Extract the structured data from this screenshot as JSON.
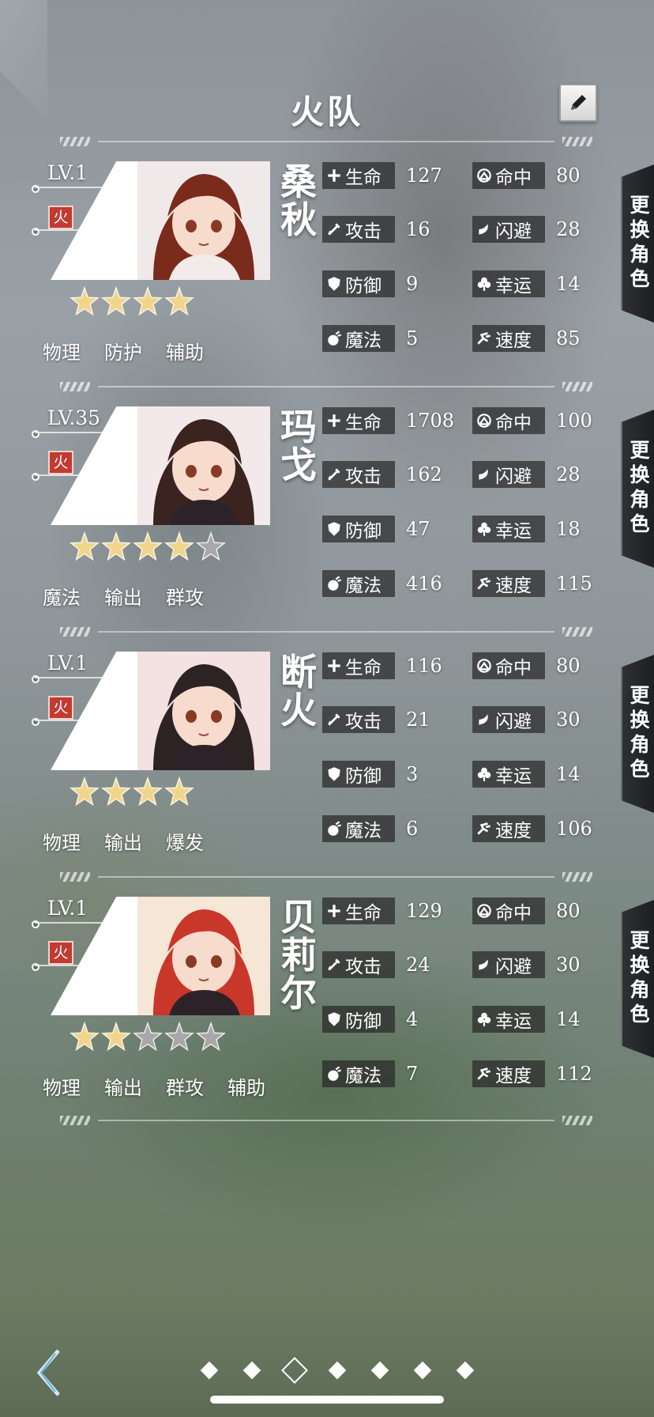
{
  "header": {
    "title": "火队",
    "edit_icon": "pencil-icon"
  },
  "swap_label": "更换角色",
  "stat_labels": {
    "hp": "生命",
    "atk": "攻击",
    "def": "防御",
    "mag": "魔法",
    "hit": "命中",
    "eva": "闪避",
    "luck": "幸运",
    "spd": "速度"
  },
  "characters": [
    {
      "level": "LV.1",
      "element": "火",
      "name": "桑秋",
      "stars": 4,
      "max_stars": 4,
      "tags": [
        "物理",
        "防护",
        "辅助"
      ],
      "stats": {
        "hp": "127",
        "atk": "16",
        "def": "9",
        "mag": "5",
        "hit": "80",
        "eva": "28",
        "luck": "14",
        "spd": "85"
      },
      "hair_color": "#7a2b1c"
    },
    {
      "level": "LV.35",
      "element": "火",
      "name": "玛戈",
      "stars": 4,
      "max_stars": 5,
      "tags": [
        "魔法",
        "输出",
        "群攻"
      ],
      "stats": {
        "hp": "1708",
        "atk": "162",
        "def": "47",
        "mag": "416",
        "hit": "100",
        "eva": "28",
        "luck": "18",
        "spd": "115"
      },
      "hair_color": "#3b2420"
    },
    {
      "level": "LV.1",
      "element": "火",
      "name": "断火",
      "stars": 4,
      "max_stars": 4,
      "tags": [
        "物理",
        "输出",
        "爆发"
      ],
      "stats": {
        "hp": "116",
        "atk": "21",
        "def": "3",
        "mag": "6",
        "hit": "80",
        "eva": "30",
        "luck": "14",
        "spd": "106"
      },
      "hair_color": "#2d2224"
    },
    {
      "level": "LV.1",
      "element": "火",
      "name": "贝莉尔",
      "stars": 2,
      "max_stars": 5,
      "tags": [
        "物理",
        "输出",
        "群攻",
        "辅助"
      ],
      "stats": {
        "hp": "129",
        "atk": "24",
        "def": "4",
        "mag": "7",
        "hit": "80",
        "eva": "30",
        "luck": "14",
        "spd": "112"
      },
      "hair_color": "#c8372a"
    }
  ],
  "pager": {
    "count": 7,
    "active_index": 2
  },
  "colors": {
    "element_badge": "#c23a30",
    "star_gold": "#f1d58a",
    "star_grey": "#a8a8a8"
  }
}
